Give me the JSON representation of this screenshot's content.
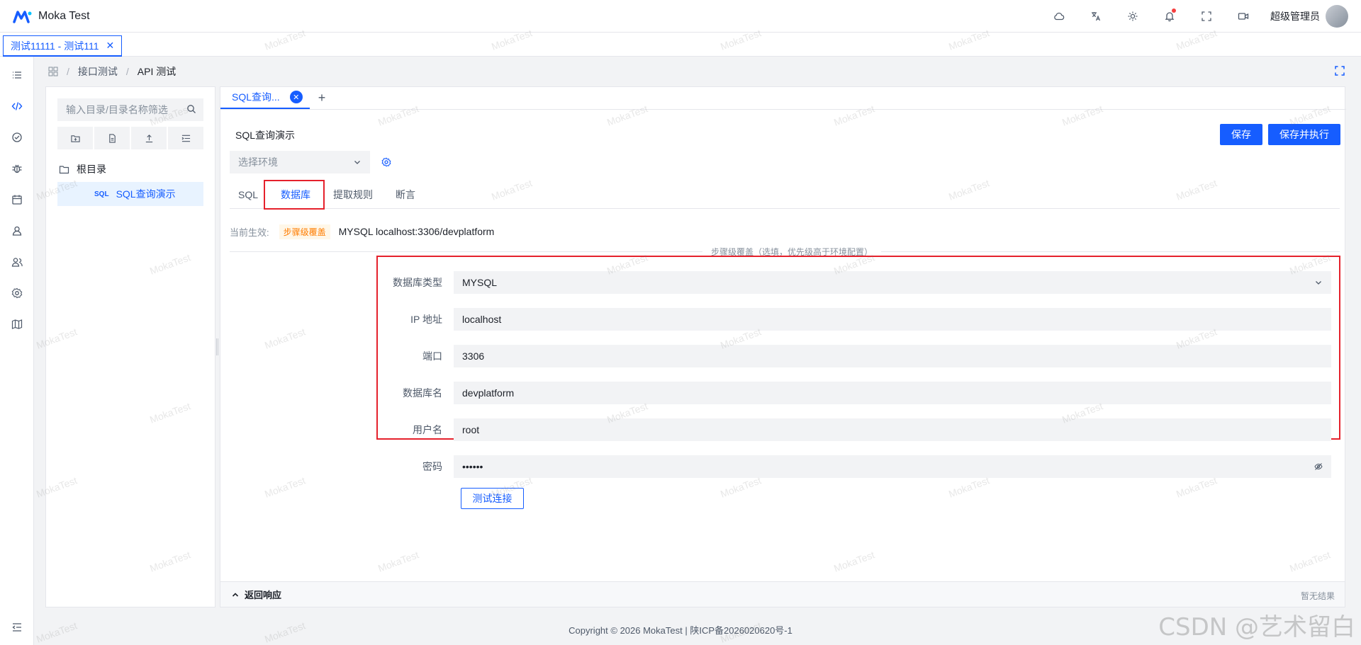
{
  "app": {
    "title": "Moka Test"
  },
  "header": {
    "user_name": "超级管理员"
  },
  "top_tab": {
    "label": "测试11111 - 测试111",
    "close": "✕"
  },
  "breadcrumb": {
    "items": [
      "接口测试",
      "API 测试"
    ],
    "sep": "/"
  },
  "tree": {
    "search_placeholder": "输入目录/目录名称筛选",
    "root_label": "根目录",
    "node_badge": "SQL",
    "node_label": "SQL查询演示"
  },
  "case_tab": {
    "label": "SQL查询...",
    "add": "+"
  },
  "case": {
    "title": "SQL查询演示",
    "save": "保存",
    "save_run": "保存并执行",
    "env_placeholder": "选择环境"
  },
  "sub_tabs": [
    "SQL",
    "数据库",
    "提取规则",
    "断言"
  ],
  "effect": {
    "label": "当前生效:",
    "tag": "步骤级覆盖",
    "value": "MYSQL localhost:3306/devplatform"
  },
  "divider_text": "步骤级覆盖（选填，优先级高于环境配置）",
  "form": {
    "db_type_label": "数据库类型",
    "db_type": "MYSQL",
    "ip_label": "IP 地址",
    "ip": "localhost",
    "port_label": "端口",
    "port": "3306",
    "db_name_label": "数据库名",
    "db_name": "devplatform",
    "user_label": "用户名",
    "user": "root",
    "pwd_label": "密码",
    "pwd": "••••••",
    "test_conn": "测试连接"
  },
  "response": {
    "title": "返回响应",
    "empty": "暂无结果"
  },
  "footer": {
    "text": "Copyright © 2026 MokaTest | 陕ICP备2026020620号-1"
  },
  "watermark": {
    "text": "MokaTest",
    "csdn": "CSDN @艺术留白"
  },
  "colors": {
    "primary": "#165dff",
    "highlight": "#e5212c",
    "tag_bg": "#fff7e8",
    "tag_text": "#ff7d00"
  }
}
